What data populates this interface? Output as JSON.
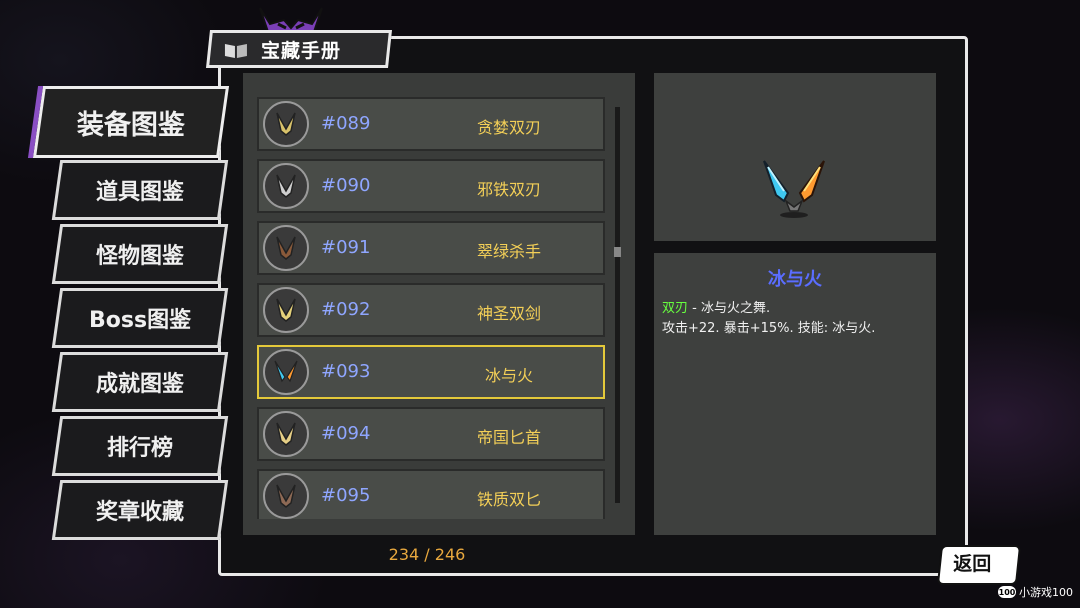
{
  "window": {
    "title": "宝藏手册"
  },
  "sidebar": {
    "items": [
      {
        "label": "装备图鉴",
        "active": true
      },
      {
        "label": "道具图鉴",
        "active": false
      },
      {
        "label": "怪物图鉴",
        "active": false
      },
      {
        "label": "Boss图鉴",
        "active": false
      },
      {
        "label": "成就图鉴",
        "active": false
      },
      {
        "label": "排行榜",
        "active": false
      },
      {
        "label": "奖章收藏",
        "active": false
      }
    ]
  },
  "list": {
    "items": [
      {
        "num": "#089",
        "name": "贪婪双刃",
        "color": "#d8c26a"
      },
      {
        "num": "#090",
        "name": "邪铁双刃",
        "color": "#cfcfcf"
      },
      {
        "num": "#091",
        "name": "翠绿杀手",
        "color": "#8a5a3a"
      },
      {
        "num": "#092",
        "name": "神圣双剑",
        "color": "#e5d17a"
      },
      {
        "num": "#093",
        "name": "冰与火",
        "color": "#ff9a30",
        "selected": true
      },
      {
        "num": "#094",
        "name": "帝国匕首",
        "color": "#e6cf86"
      },
      {
        "num": "#095",
        "name": "铁质双匕",
        "color": "#8e6a55"
      }
    ],
    "counter": "234 / 246"
  },
  "detail": {
    "title": "冰与火",
    "type_label": "双刃",
    "line1": " - 冰与火之舞.",
    "line2": "攻击+22. 暴击+15%. 技能: 冰与火."
  },
  "buttons": {
    "back": "返回"
  },
  "watermark": {
    "logo": "100",
    "text": "小游戏100"
  },
  "colors": {
    "accent": "#8a4fc4",
    "selected_border": "#e4c93a",
    "item_name": "#f3cf57",
    "item_num": "#8fa6ff",
    "detail_title": "#5a6dff",
    "type_label": "#67ff3e",
    "counter": "#e8a83e"
  }
}
